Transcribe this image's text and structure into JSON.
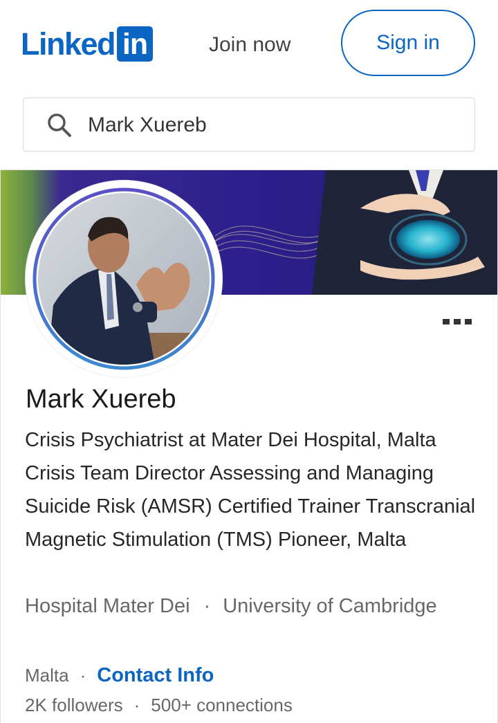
{
  "header": {
    "logo_text": "Linked",
    "logo_box": "in",
    "join_label": "Join now",
    "signin_label": "Sign in"
  },
  "search": {
    "value": "Mark Xuereb",
    "icon": "search-icon"
  },
  "profile": {
    "name": "Mark Xuereb",
    "headline": "Crisis Psychiatrist at Mater Dei Hospital, Malta Crisis Team Director Assessing and Managing Suicide Risk (AMSR) Certified Trainer Transcranial Magnetic Stimulation (TMS) Pioneer, Malta",
    "company": "Hospital Mater Dei",
    "education": "University of Cambridge",
    "separator": "·",
    "location": "Malta",
    "contact_label": "Contact Info",
    "followers": "2K followers",
    "connections": "500+ connections",
    "more_icon": "more-options-icon"
  },
  "colors": {
    "brand": "#0a66c2",
    "cover_purple": "#2d1f8c",
    "cover_green": "#8db33a"
  }
}
